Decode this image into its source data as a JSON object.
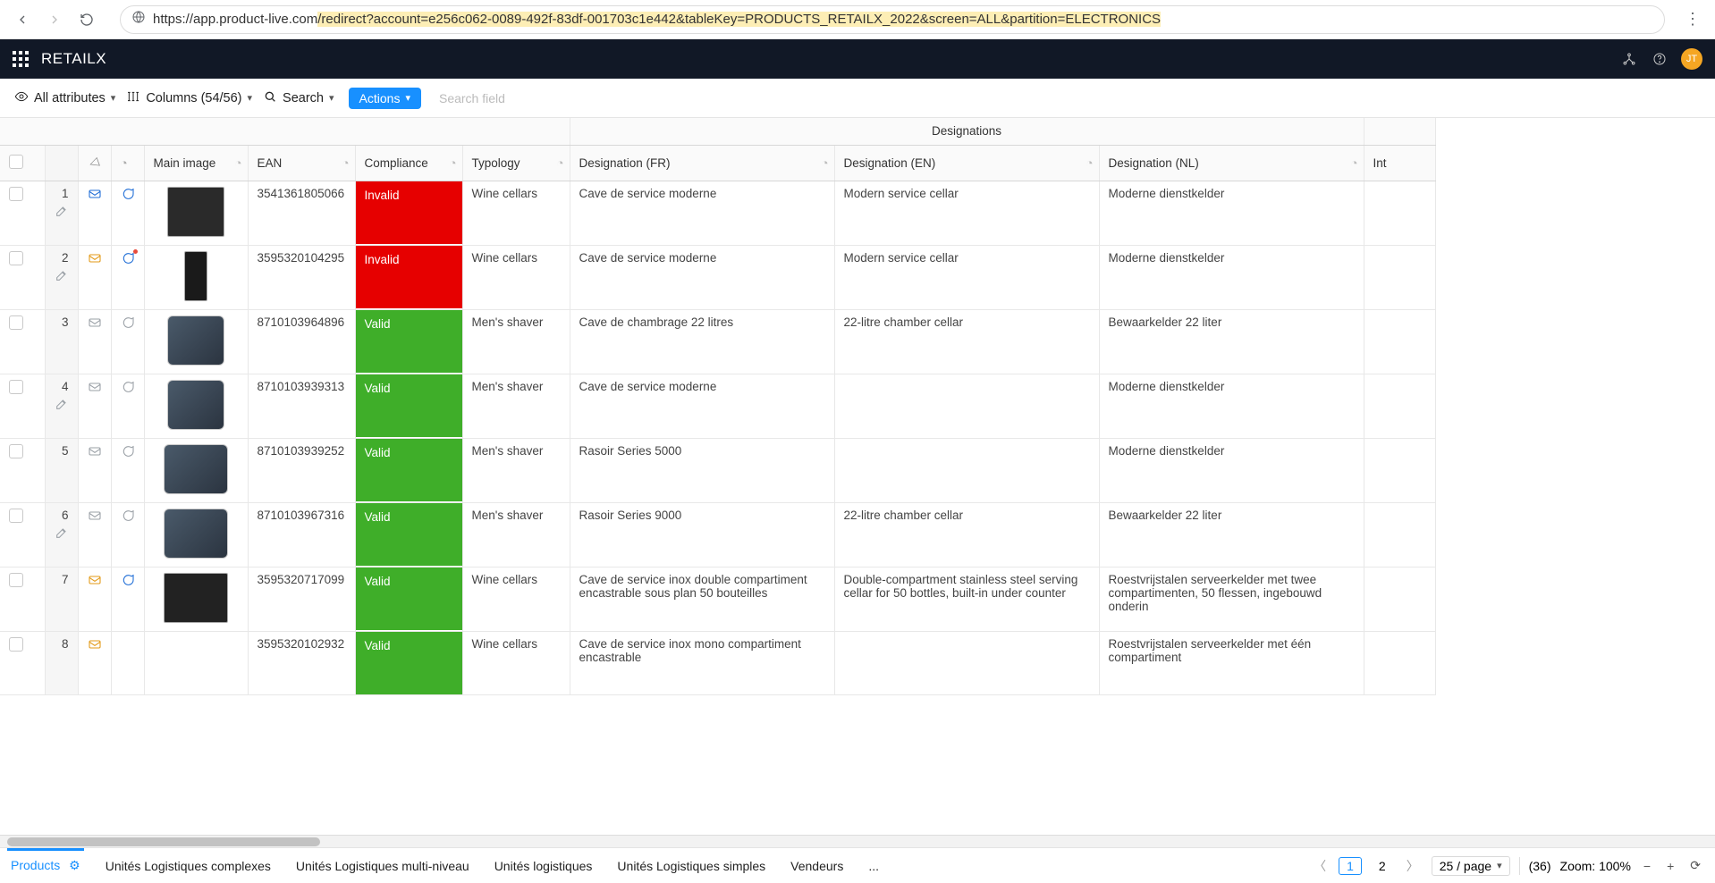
{
  "browser": {
    "url_base": "https://app.product-live.com",
    "url_query": "/redirect?account=e256c062-0089-492f-83df-001703c1e442&tableKey=PRODUCTS_RETAILX_2022&screen=ALL&partition=ELECTRONICS"
  },
  "app": {
    "brand": "RETAILX",
    "avatar": "JT"
  },
  "toolbar": {
    "all_attributes": "All attributes",
    "columns": "Columns (54/56)",
    "search": "Search",
    "actions": "Actions",
    "search_placeholder": "Search field"
  },
  "groups": {
    "designations": "Designations"
  },
  "columns": {
    "main_image": "Main image",
    "ean": "EAN",
    "compliance": "Compliance",
    "typology": "Typology",
    "designation_fr": "Designation (FR)",
    "designation_en": "Designation (EN)",
    "designation_nl": "Designation (NL)",
    "intro": "Int"
  },
  "compliance_labels": {
    "invalid": "Invalid",
    "valid": "Valid"
  },
  "rows": [
    {
      "n": "1",
      "mail": "blue",
      "msg": "blue",
      "edit": true,
      "img": "dark",
      "ean": "3541361805066",
      "comp": "invalid",
      "typ": "Wine cellars",
      "fr": "Cave de service moderne",
      "en": "Modern service cellar",
      "nl": "Moderne dienstkelder"
    },
    {
      "n": "2",
      "mail": "orange",
      "msg": "blue",
      "edit": true,
      "notif": true,
      "img": "dark-narrow",
      "ean": "3595320104295",
      "comp": "invalid",
      "typ": "Wine cellars",
      "fr": "Cave de service moderne",
      "en": "Modern service cellar",
      "nl": "Moderne dienstkelder"
    },
    {
      "n": "3",
      "mail": "grey",
      "msg": "grey",
      "img": "shaver",
      "ean": "8710103964896",
      "comp": "valid",
      "typ": "Men's shaver",
      "fr": "Cave de chambrage 22 litres",
      "en": "22-litre chamber cellar",
      "nl": "Bewaarkelder 22 liter"
    },
    {
      "n": "4",
      "mail": "grey",
      "msg": "grey",
      "edit": true,
      "img": "shaver",
      "ean": "8710103939313",
      "comp": "valid",
      "typ": "Men's shaver",
      "fr": "Cave de service moderne",
      "en": "",
      "nl": "Moderne dienstkelder"
    },
    {
      "n": "5",
      "mail": "grey",
      "msg": "grey",
      "img": "shaver2",
      "ean": "8710103939252",
      "comp": "valid",
      "typ": "Men's shaver",
      "fr": "Rasoir Series 5000",
      "en": "",
      "nl": "Moderne dienstkelder"
    },
    {
      "n": "6",
      "mail": "grey",
      "msg": "grey",
      "edit": true,
      "img": "shaver2",
      "ean": "8710103967316",
      "comp": "valid",
      "typ": "Men's shaver",
      "fr": "Rasoir Series 9000",
      "en": "22-litre chamber cellar",
      "nl": "Bewaarkelder 22 liter"
    },
    {
      "n": "7",
      "mail": "orange",
      "msg": "blue",
      "img": "cellar2",
      "ean": "3595320717099",
      "comp": "valid",
      "typ": "Wine cellars",
      "fr": "Cave de service inox double compartiment encastrable sous plan 50 bouteilles",
      "en": "Double-compartment stainless steel serving cellar for 50 bottles, built-in under counter",
      "nl": "Roestvrijstalen serveerkelder met twee compartimenten, 50 flessen, ingebouwd onderin"
    },
    {
      "n": "8",
      "mail": "orange",
      "msg": "",
      "img": "none",
      "ean": "3595320102932",
      "comp": "valid",
      "typ": "Wine cellars",
      "fr": "Cave de service inox mono compartiment encastrable",
      "en": "",
      "nl": "Roestvrijstalen serveerkelder met één compartiment"
    }
  ],
  "footer": {
    "tabs": [
      "Products",
      "Unités Logistiques complexes",
      "Unités Logistiques multi-niveau",
      "Unités logistiques",
      "Unités Logistiques simples",
      "Vendeurs"
    ],
    "more": "...",
    "page_current": "1",
    "page_other": "2",
    "page_size": "25 / page",
    "total": "(36)",
    "zoom_label": "Zoom: 100%"
  }
}
